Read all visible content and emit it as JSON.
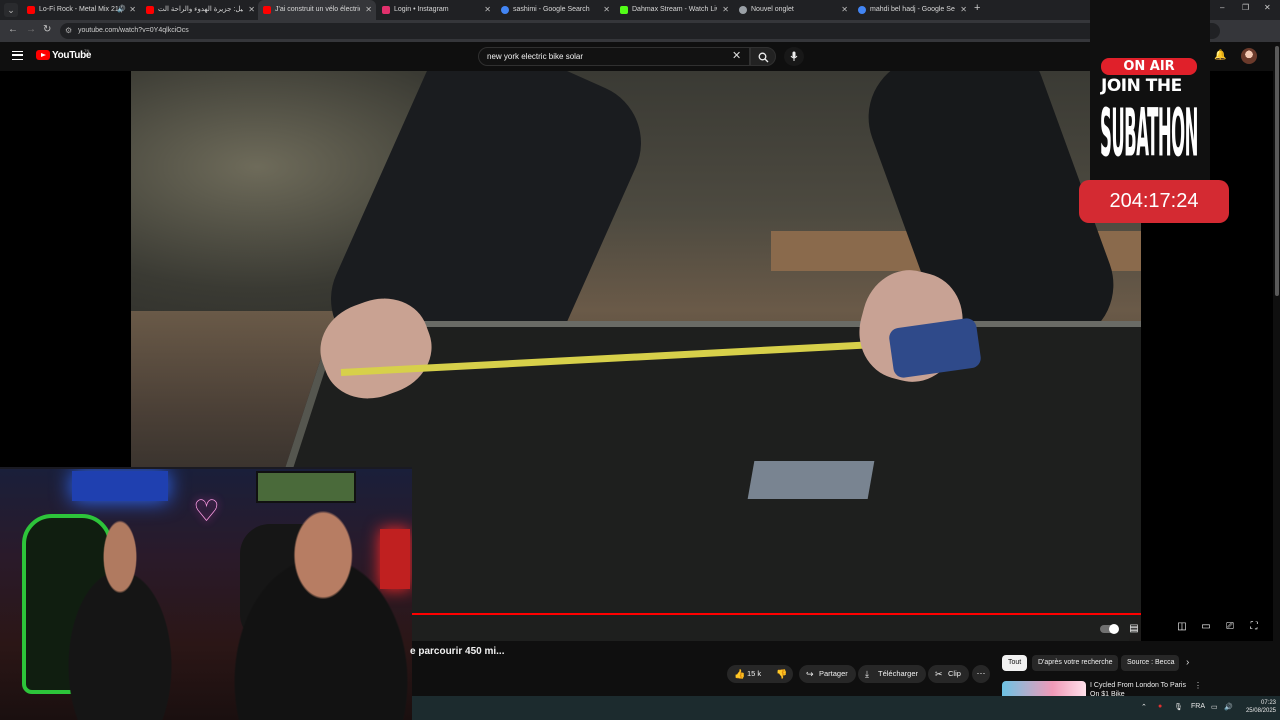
{
  "browser": {
    "tabs": [
      {
        "title": "Lo-Fi Rock - Metal Mix 21 |",
        "color": "#ff0000",
        "audio": true
      },
      {
        "title": "السيشيل: جزيرة الهدوء والراحة الت",
        "color": "#ff0000",
        "audio": false
      },
      {
        "title": "J'ai construit un vélo électrique",
        "color": "#ff0000",
        "audio": false,
        "active": true
      },
      {
        "title": "Login • Instagram",
        "color": "#e1306c",
        "audio": false
      },
      {
        "title": "sashimi - Google Search",
        "color": "#4285f4",
        "audio": false
      },
      {
        "title": "Dahmax Stream - Watch Live o",
        "color": "#53fc18",
        "audio": false
      },
      {
        "title": "Nouvel onglet",
        "color": "#9aa0a6",
        "audio": false
      },
      {
        "title": "mahdi bel hadj - Google Search",
        "color": "#4285f4",
        "audio": false
      }
    ],
    "new_tab": "+",
    "minimize": "–",
    "maximize": "❐",
    "close": "✕",
    "url": "youtube.com/watch?v=0Y4qlkciOcs"
  },
  "youtube": {
    "logo_text": "YouTube",
    "logo_suffix": "TN",
    "search_query": "new york electric bike solar",
    "video_title": "e parcourir 450 mi...",
    "actions": {
      "like_count": "15 k",
      "share": "Partager",
      "download": "Télécharger",
      "clip": "Clip",
      "more": "···"
    },
    "chips": [
      "Tout",
      "D'après votre recherche",
      "Source : Becca"
    ],
    "recommendation": {
      "title": "I Cycled From London To Paris On $1 Bike"
    },
    "progress": 1.0
  },
  "overlay": {
    "on_air": "ON AIR",
    "join_the": "JOIN THE",
    "subathon": "SUBATHON",
    "timer": "204:17:24"
  },
  "taskbar": {
    "language": "FRA",
    "time": "07:23",
    "date": "25/08/2025"
  }
}
